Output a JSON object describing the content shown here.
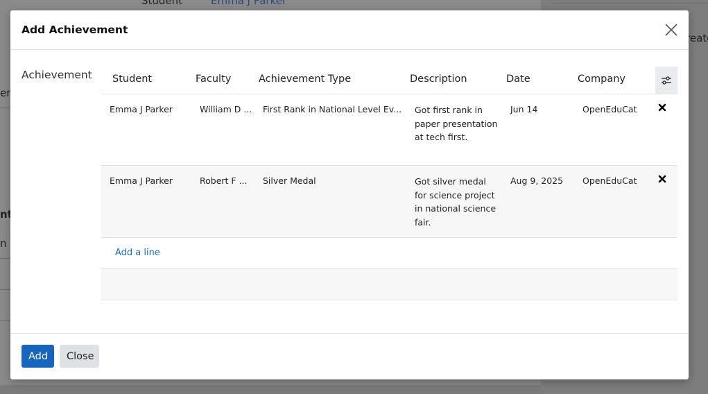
{
  "background": {
    "top_label": "Student",
    "top_value": "Emma J Parker",
    "right_text": "reate",
    "left_fragments": [
      "en",
      "nt",
      "n N"
    ]
  },
  "modal": {
    "title": "Add Achievement",
    "field_label": "Achievement",
    "columns": [
      "Student",
      "Faculty",
      "Achievement Type",
      "Description",
      "Date",
      "Company"
    ],
    "rows": [
      {
        "student": "Emma J Parker",
        "faculty": "William D ...",
        "achievement_type": "First Rank in National Level Ev...",
        "description": "Got first rank in paper presentation at tech first.",
        "date": "Jun 14",
        "company": "OpenEduCat"
      },
      {
        "student": "Emma J Parker",
        "faculty": "Robert F ...",
        "achievement_type": "Silver Medal",
        "description": "Got silver medal for science project in national science fair.",
        "date": "Aug 9, 2025",
        "company": "OpenEduCat"
      }
    ],
    "add_line": "Add a line",
    "buttons": {
      "add": "Add",
      "close": "Close"
    }
  }
}
